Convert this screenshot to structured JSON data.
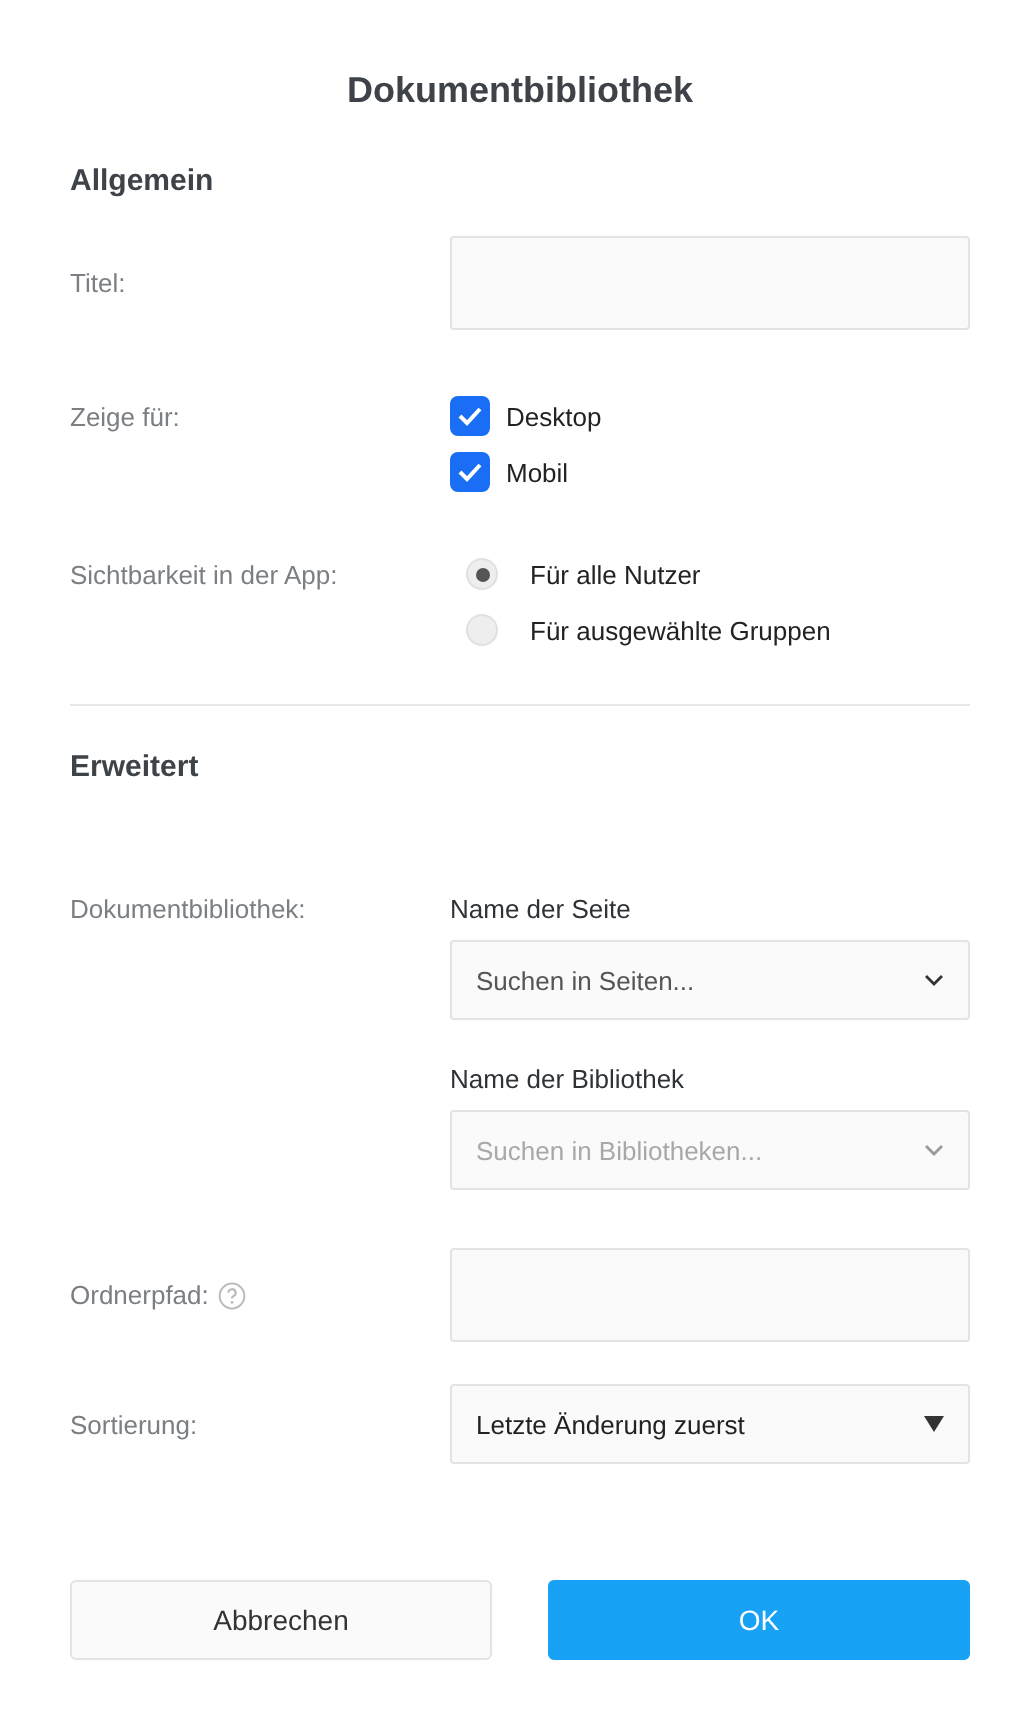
{
  "title": "Dokumentbibliothek",
  "general": {
    "heading": "Allgemein",
    "title_field": {
      "label": "Titel:"
    },
    "show_for": {
      "label": "Zeige für:",
      "options": [
        {
          "label": "Desktop",
          "checked": true
        },
        {
          "label": "Mobil",
          "checked": true
        }
      ]
    },
    "visibility": {
      "label": "Sichtbarkeit in der App:",
      "options": [
        {
          "label": "Für alle Nutzer",
          "selected": true
        },
        {
          "label": "Für ausgewählte Gruppen",
          "selected": false
        }
      ]
    }
  },
  "advanced": {
    "heading": "Erweitert",
    "library": {
      "label": "Dokumentbibliothek:",
      "selects": [
        {
          "label": "Name der Seite",
          "placeholder": "Suchen in Seiten...",
          "disabled": false
        },
        {
          "label": "Name der Bibliothek",
          "placeholder": "Suchen in Bibliotheken...",
          "disabled": true
        }
      ]
    },
    "folder_path": {
      "label": "Ordnerpfad:"
    },
    "sorting": {
      "label": "Sortierung:",
      "value": "Letzte Änderung zuerst"
    }
  },
  "buttons": [
    {
      "label": "Abbrechen",
      "kind": "secondary"
    },
    {
      "label": "OK",
      "kind": "primary"
    }
  ]
}
